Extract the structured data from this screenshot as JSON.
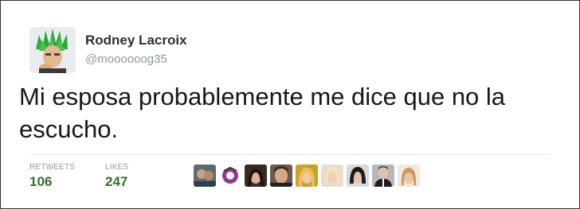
{
  "author": {
    "display_name": "Rodney Lacroix",
    "handle": "@moooooog35"
  },
  "tweet": {
    "text": "Mi esposa probablemente me dice que no la escucho."
  },
  "stats": {
    "retweets_label": "RETWEETS",
    "retweets_count": "106",
    "likes_label": "LIKES",
    "likes_count": "247"
  },
  "colors": {
    "stat_value": "#3a6a31",
    "muted": "#8899a6",
    "text": "#141823"
  },
  "likers": [
    {
      "icon": "avatar-photo-1"
    },
    {
      "icon": "avatar-photo-2"
    },
    {
      "icon": "avatar-photo-3"
    },
    {
      "icon": "avatar-photo-4"
    },
    {
      "icon": "avatar-photo-5"
    },
    {
      "icon": "avatar-photo-6"
    },
    {
      "icon": "avatar-photo-7"
    },
    {
      "icon": "avatar-photo-8"
    },
    {
      "icon": "avatar-photo-9"
    }
  ]
}
